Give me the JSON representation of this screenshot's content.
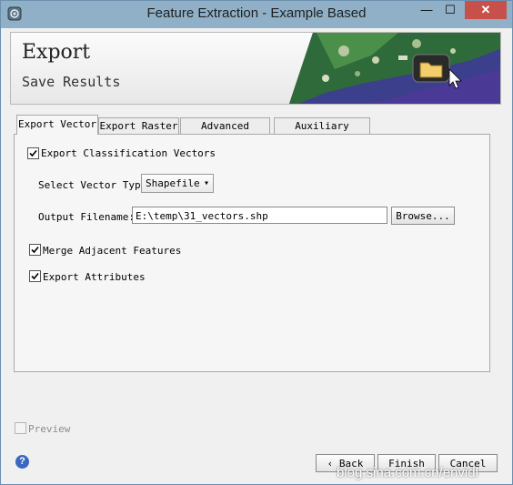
{
  "window": {
    "title": "Feature Extraction - Example Based",
    "min_label": "—",
    "max_label": "☐",
    "close_label": "✕"
  },
  "header": {
    "title": "Export",
    "subtitle": "Save Results"
  },
  "tabs": [
    {
      "label": "Export Vector",
      "active": true
    },
    {
      "label": "Export Raster",
      "active": false
    },
    {
      "label": "Advanced Export",
      "active": false
    },
    {
      "label": "Auxiliary Export",
      "active": false
    }
  ],
  "vector": {
    "export_vectors": {
      "label": "Export Classification Vectors",
      "checked": true
    },
    "vector_type": {
      "label": "Select Vector Type",
      "value": "Shapefile"
    },
    "output": {
      "label": "Output Filename:",
      "value": "E:\\temp\\31_vectors.shp",
      "browse_label": "Browse..."
    },
    "merge": {
      "label": "Merge Adjacent Features",
      "checked": true
    },
    "attributes": {
      "label": "Export Attributes",
      "checked": true
    }
  },
  "preview": {
    "label": "Preview",
    "checked": false,
    "enabled": false
  },
  "footer": {
    "help_label": "?",
    "back_label": "Back",
    "finish_label": "Finish",
    "cancel_label": "Cancel"
  },
  "watermark": "blog.sina.com.cn/envidl"
}
